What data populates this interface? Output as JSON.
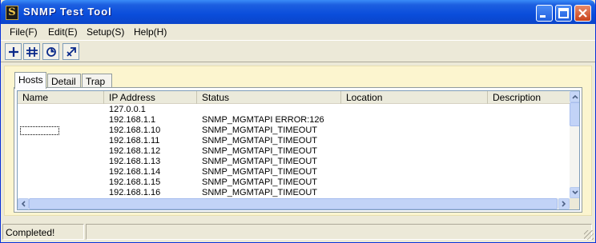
{
  "window": {
    "title": "SNMP Test Tool",
    "app_icon_glyph": "S",
    "controls": [
      "minimize-icon",
      "maximize-icon",
      "close-icon"
    ]
  },
  "menu": {
    "items": [
      {
        "label": "File(F)"
      },
      {
        "label": "Edit(E)"
      },
      {
        "label": "Setup(S)"
      },
      {
        "label": "Help(H)"
      }
    ]
  },
  "toolbar": {
    "buttons": [
      {
        "icon": "add-icon"
      },
      {
        "icon": "add-range-icon"
      },
      {
        "icon": "refresh-icon"
      },
      {
        "icon": "stop-icon"
      }
    ]
  },
  "tabs": [
    {
      "label": "Hosts",
      "active": true
    },
    {
      "label": "Detail",
      "active": false
    },
    {
      "label": "Trap",
      "active": false
    }
  ],
  "hosts_table": {
    "columns": [
      "Name",
      "IP Address",
      "Status",
      "Location",
      "Description"
    ],
    "rows": [
      {
        "name": "",
        "ip": "127.0.0.1",
        "status": "",
        "location": "",
        "description": ""
      },
      {
        "name": "",
        "ip": "192.168.1.1",
        "status": "SNMP_MGMTAPI ERROR:126",
        "location": "",
        "description": ""
      },
      {
        "name": "",
        "ip": "192.168.1.10",
        "status": "SNMP_MGMTAPI_TIMEOUT",
        "location": "",
        "description": ""
      },
      {
        "name": "",
        "ip": "192.168.1.11",
        "status": "SNMP_MGMTAPI_TIMEOUT",
        "location": "",
        "description": ""
      },
      {
        "name": "",
        "ip": "192.168.1.12",
        "status": "SNMP_MGMTAPI_TIMEOUT",
        "location": "",
        "description": ""
      },
      {
        "name": "",
        "ip": "192.168.1.13",
        "status": "SNMP_MGMTAPI_TIMEOUT",
        "location": "",
        "description": ""
      },
      {
        "name": "",
        "ip": "192.168.1.14",
        "status": "SNMP_MGMTAPI_TIMEOUT",
        "location": "",
        "description": ""
      },
      {
        "name": "",
        "ip": "192.168.1.15",
        "status": "SNMP_MGMTAPI_TIMEOUT",
        "location": "",
        "description": ""
      },
      {
        "name": "",
        "ip": "192.168.1.16",
        "status": "SNMP_MGMTAPI_TIMEOUT",
        "location": "",
        "description": ""
      }
    ]
  },
  "statusbar": {
    "text": "Completed!",
    "second_pane": ""
  },
  "colors": {
    "title_bar": "#0a4ddb",
    "tab_area_background": "#fcf5cf",
    "window_face": "#ece9d8"
  }
}
